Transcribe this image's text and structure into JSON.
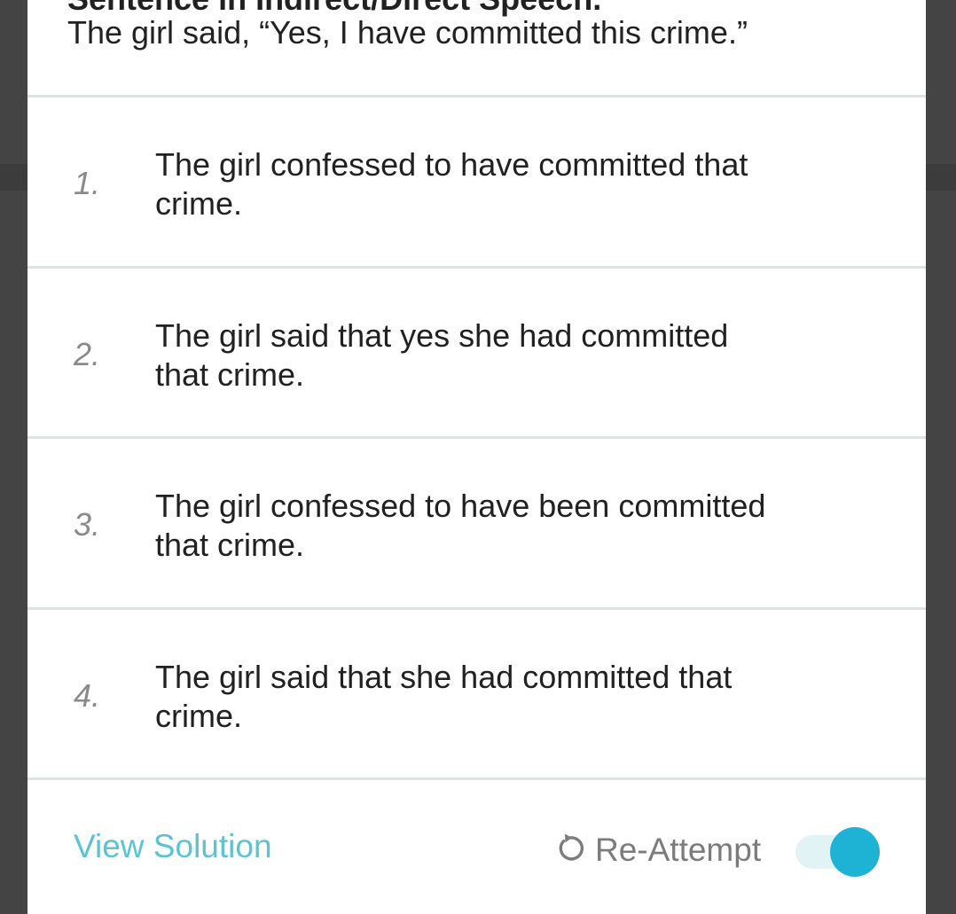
{
  "question": {
    "heading": "Sentence in Indirect/Direct Speech.",
    "text": "The girl said, “Yes, I have committed this crime.”"
  },
  "options": [
    {
      "number": "1.",
      "line1": "The girl confessed to have committed that",
      "line2": "crime."
    },
    {
      "number": "2.",
      "line1": "The girl said that yes she had committed",
      "line2": "that crime."
    },
    {
      "number": "3.",
      "line1": "The girl confessed to have been committed",
      "line2": "that crime."
    },
    {
      "number": "4.",
      "line1": "The girl said that she had committed that",
      "line2": "crime."
    }
  ],
  "footer": {
    "view_solution_label": "View Solution",
    "reattempt_label": "Re-Attempt",
    "reattempt_icon": "refresh-icon",
    "toggle_state": "on"
  },
  "colors": {
    "accent": "#1eb2d4",
    "link": "#5bc3d2",
    "text": "#212121",
    "muted": "#8a8a8a",
    "backdrop": "#444444",
    "divider": "#dde3e3"
  }
}
